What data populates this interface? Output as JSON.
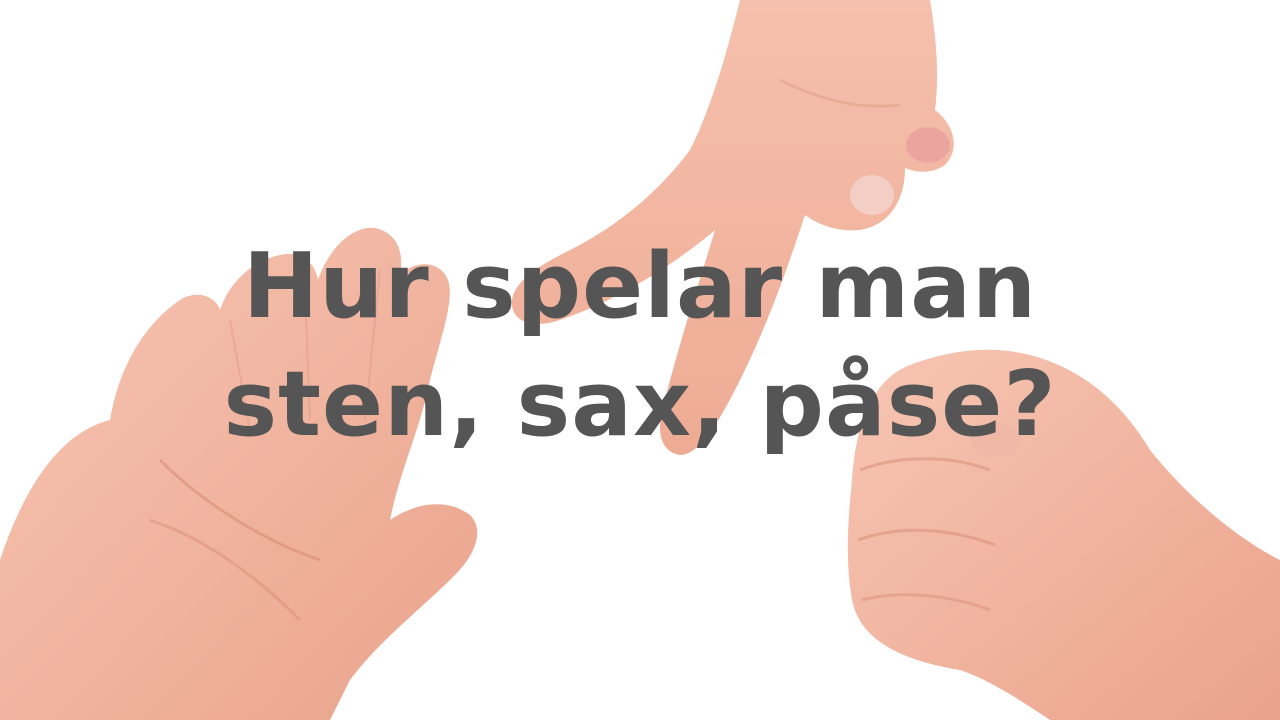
{
  "image": {
    "subject": "Three children's hands showing the rock-paper-scissors gestures on a white background",
    "background_color": "#ffffff",
    "skin_color": "#f2b59f",
    "text_color": "#555555"
  },
  "headline": {
    "line1": "Hur spelar man",
    "line2": "sten, sax, påse?"
  }
}
